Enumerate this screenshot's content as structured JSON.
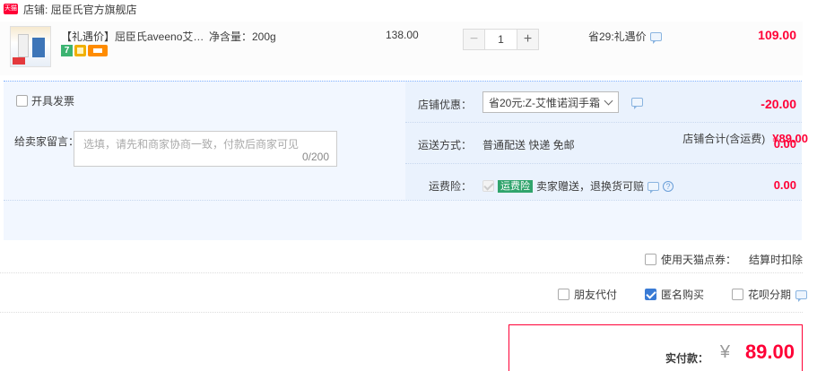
{
  "shop": {
    "badge": "天猫",
    "label": "店铺: 屈臣氏官方旗舰店"
  },
  "item": {
    "title": "【礼遇价】屈臣氏aveeno艾惟诺",
    "spec": "净含量：200g",
    "unit_price": "138.00",
    "quantity": "1",
    "minus": "−",
    "plus": "+",
    "promo": "省29:礼遇价",
    "total": "109.00",
    "icon7": "7"
  },
  "invoice": {
    "label": "开具发票"
  },
  "message": {
    "label": "给卖家留言：",
    "placeholder": "选填，请先和商家协商一致，付款后商家可见",
    "count": "0/200"
  },
  "coupon": {
    "label": "店铺优惠：",
    "selected": "省20元:Z-艾惟诺润手霜",
    "amount": "-20.00"
  },
  "shipping": {
    "label": "运送方式：",
    "text": "普通配送 快递 免邮",
    "amount": "0.00"
  },
  "insurance": {
    "label": "运费险：",
    "badge": "运费险",
    "text": "卖家赠送，退换货可赔",
    "help": "?",
    "amount": "0.00"
  },
  "shop_total": {
    "label": "店铺合计(含运费)",
    "amount": "¥89.00"
  },
  "tmall_points": {
    "label": "使用天猫点券：",
    "right": "结算时扣除"
  },
  "options": {
    "friend_pay": "朋友代付",
    "anonymous": "匿名购买",
    "huabei": "花呗分期"
  },
  "payment": {
    "label": "实付款：",
    "currency": "¥",
    "amount": "89.00"
  },
  "colors": {
    "accent": "#ff0036",
    "panel_bg": "#f2f7ff",
    "checkbox_blue": "#3a7bd5",
    "insurance_green": "#30a46c"
  }
}
